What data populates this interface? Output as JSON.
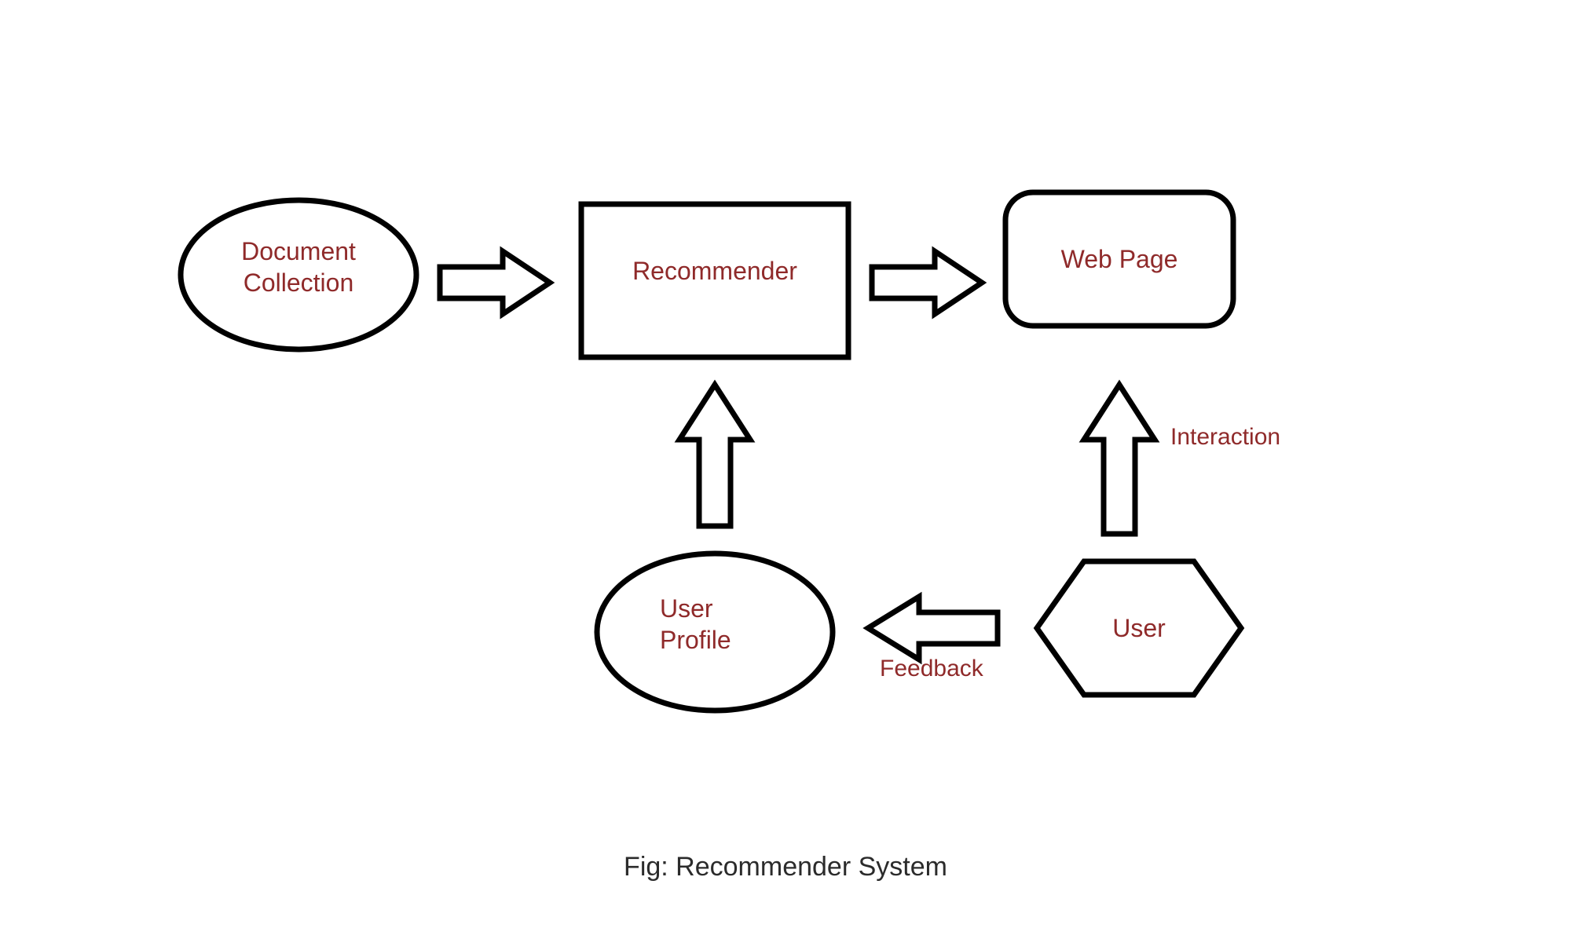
{
  "caption": "Fig: Recommender System",
  "nodes": {
    "document_collection": {
      "label_line1": "Document",
      "label_line2": "Collection",
      "shape": "ellipse"
    },
    "recommender": {
      "label": "Recommender",
      "shape": "rectangle"
    },
    "web_page": {
      "label": "Web Page",
      "shape": "rounded-rectangle"
    },
    "user_profile": {
      "label_line1": "User",
      "label_line2": "Profile",
      "shape": "ellipse"
    },
    "user": {
      "label": "User",
      "shape": "hexagon"
    }
  },
  "edges": {
    "doc_to_recommender": {
      "from": "document_collection",
      "to": "recommender",
      "direction": "right"
    },
    "recommender_to_webpage": {
      "from": "recommender",
      "to": "web_page",
      "direction": "right"
    },
    "user_to_webpage": {
      "from": "user",
      "to": "web_page",
      "direction": "up",
      "label": "Interaction"
    },
    "user_to_userprofile": {
      "from": "user",
      "to": "user_profile",
      "direction": "left",
      "label": "Feedback"
    },
    "userprofile_to_recommender": {
      "from": "user_profile",
      "to": "recommender",
      "direction": "up"
    }
  },
  "colors": {
    "stroke": "#000000",
    "text_primary": "#8f2a2a",
    "caption": "#2b2b2b",
    "background": "#ffffff"
  }
}
